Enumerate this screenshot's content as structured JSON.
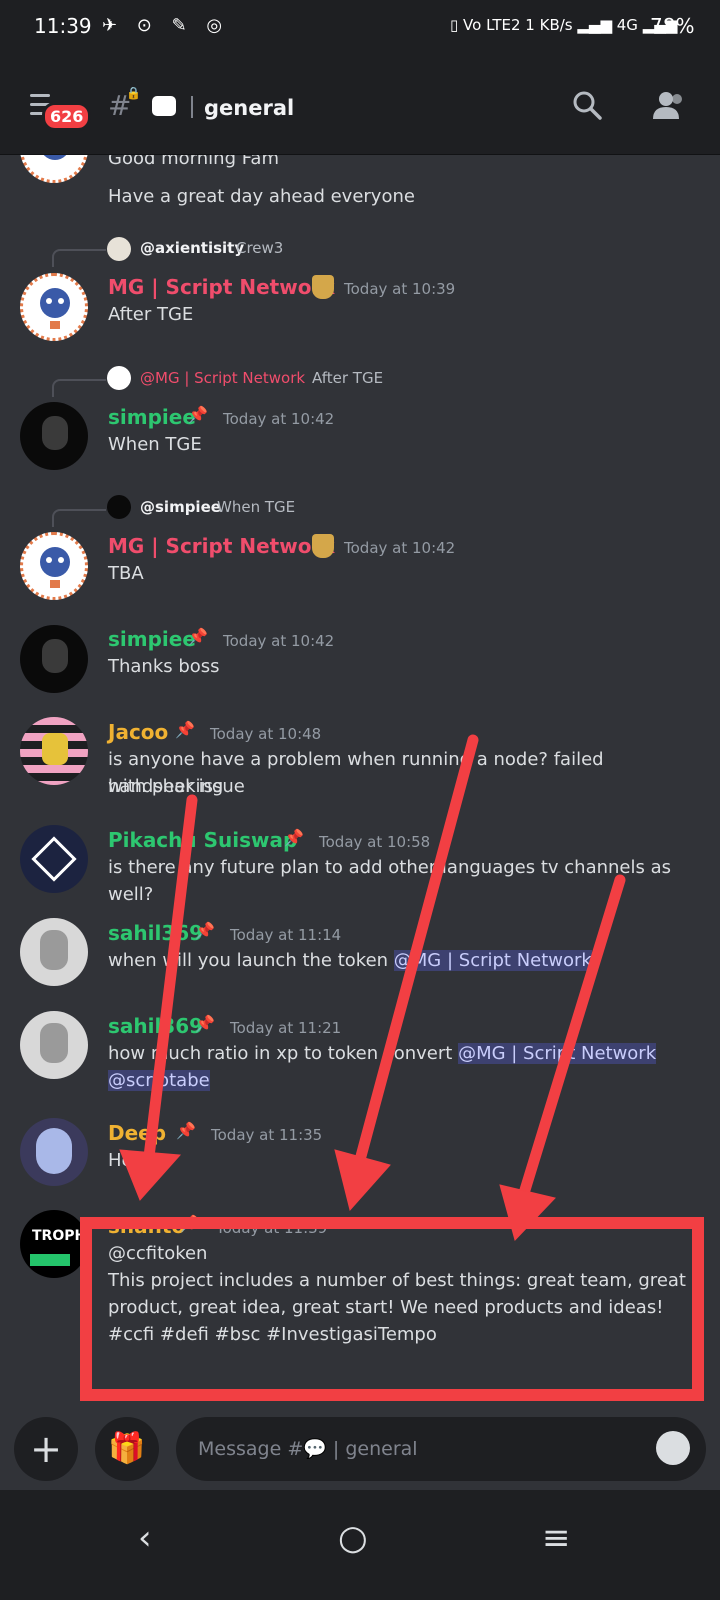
{
  "status": {
    "time": "11:39",
    "left_icons": "✈ ⊙ ✎ ◎",
    "right_icons": "▯ Vo LTE2  1 KB/s  ▂▄▆ 4G ▂▄▆",
    "battery": "78%"
  },
  "header": {
    "unread_count": "626",
    "channel_name": "general"
  },
  "messages": [
    {
      "text1": "Good morning Fam",
      "text2": "Have a great day ahead everyone"
    },
    {
      "reply_name": "@axientisity",
      "reply_text": "Crew3",
      "author": "MG | Script Network",
      "time": "Today at 10:39",
      "text": "After TGE"
    },
    {
      "reply_name": "@MG | Script Network",
      "reply_text": "After TGE",
      "author": "simpiee",
      "time": "Today at 10:42",
      "text": "When TGE"
    },
    {
      "reply_name": "@simpiee",
      "reply_text": "When TGE",
      "author": "MG | Script Network",
      "time": "Today at 10:42",
      "text": "TBA"
    },
    {
      "author": "simpiee",
      "time": "Today at 10:42",
      "text": "Thanks boss"
    },
    {
      "author": "Jacoo",
      "time": "Today at 10:48",
      "text1": "is anyone have a problem when running a node? failed handshaking",
      "text2": "with peer issue"
    },
    {
      "author": "Pikachu Suiswap",
      "time": "Today at 10:58",
      "text": "is there any future plan to add other languages tv channels as well?"
    },
    {
      "author": "sahil369",
      "time": "Today at 11:14",
      "text": "when will you launch the token ",
      "mention": "@MG | Script Network"
    },
    {
      "author": "sahil369",
      "time": "Today at 11:21",
      "text": "how much ratio in xp to token convert ",
      "mention": "@MG | Script Network",
      "mention2": "@scriptabe"
    },
    {
      "author": "Deep",
      "time": "Today at 11:35",
      "text": "Hey"
    },
    {
      "author": "shanto",
      "time": "Today at 11:39",
      "line1": "@ccfitoken",
      "line2": "This project includes a number of best things: great team, great",
      "line3": "product, great idea, great start! We need products and ideas!",
      "line4": "#ccfi #defi #bsc #InvestigasiTempo"
    }
  ],
  "composer": {
    "placeholder": "Message #💬 | general",
    "add_label": "+"
  },
  "avatars": {
    "trophy_text": "TROPH"
  },
  "colors": {
    "background": "#313338",
    "red_author": "#f04d6c",
    "green_author": "#2dc770",
    "yellow_author": "#f0b232",
    "arrow_red": "#f23f43"
  },
  "nav": {
    "back": "‹",
    "home": "○",
    "recents": "≡"
  }
}
